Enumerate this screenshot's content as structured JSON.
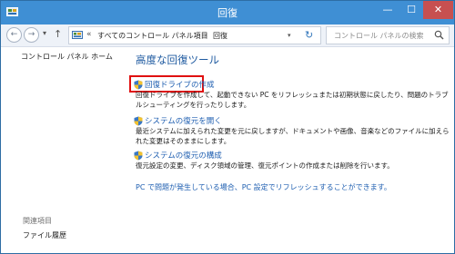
{
  "window": {
    "title": "回復",
    "controls": {
      "minimize": "—",
      "maximize": "☐",
      "close": "✕"
    }
  },
  "nav": {
    "back": "←",
    "forward": "→",
    "dropdown": "▾",
    "up": "↑",
    "address": {
      "chevron": "«",
      "crumbs": [
        "すべてのコントロール パネル項目",
        "回復"
      ],
      "separator": "›",
      "dropdown": "▾",
      "refresh": "↻"
    },
    "search": {
      "placeholder": "コントロール パネルの検索"
    }
  },
  "sidebar": {
    "home_link": "コントロール パネル ホーム",
    "related_header": "関連項目",
    "related_items": [
      "ファイル履歴"
    ]
  },
  "main": {
    "heading": "高度な回復ツール",
    "tools": [
      {
        "link": "回復ドライブの作成",
        "description": "回復ドライブを作成して、起動できない PC をリフレッシュまたは初期状態に戻したり、問題のトラブルシューティングを行ったりします。",
        "highlighted": true
      },
      {
        "link": "システムの復元を開く",
        "description": "最近システムに加えられた変更を元に戻しますが、ドキュメントや画像、音楽などのファイルに加えられた変更はそのままにします。",
        "highlighted": false
      },
      {
        "link": "システムの復元の構成",
        "description": "復元設定の変更、ディスク領域の管理、復元ポイントの作成または削除を行います。",
        "highlighted": false
      }
    ],
    "pc_refresh_link": "PC で問題が発生している場合、PC 設定でリフレッシュすることができます。"
  },
  "colors": {
    "titlebar": "#3f8fd4",
    "link": "#1f5fb1",
    "heading": "#1e5aa0",
    "highlight_border": "#e01010"
  }
}
